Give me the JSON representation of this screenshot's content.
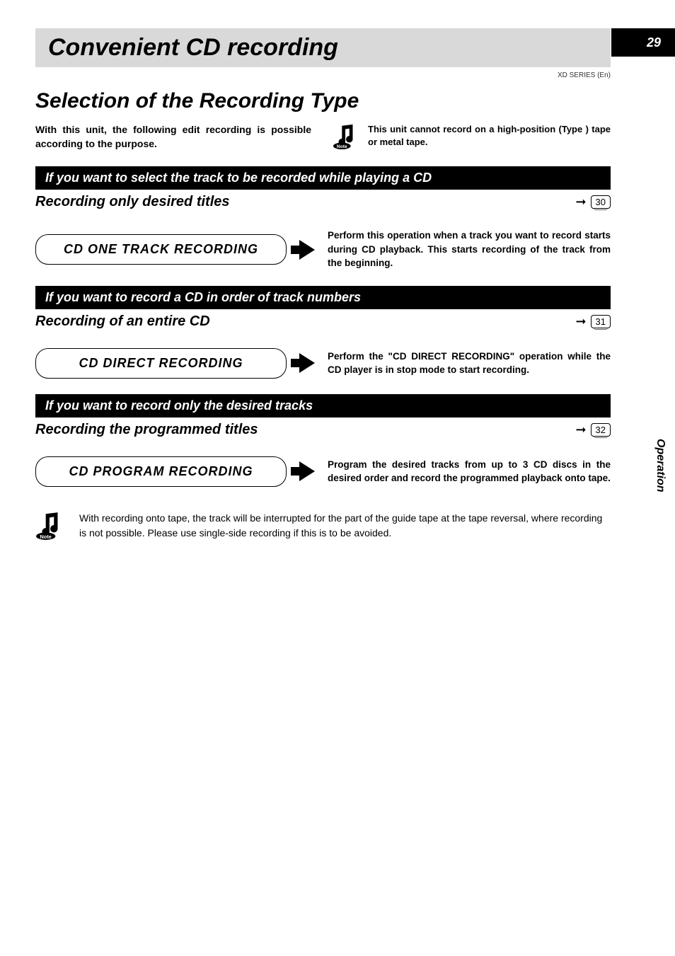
{
  "page_number": "29",
  "series_label": "XD SERIES (En)",
  "side_tab": "Operation",
  "h1": "Convenient CD recording",
  "h2": "Selection of the Recording Type",
  "intro_left": "With this unit, the following edit recording is possible according to the purpose.",
  "intro_note": "This unit cannot record on a high-position (Type ) tape or metal tape.",
  "sections": [
    {
      "bar": "If you want to select the track to be recorded while playing a CD",
      "sub": "Recording only desired titles",
      "page_ref": "30",
      "method": "CD ONE TRACK RECORDING",
      "desc": "Perform this operation when a track you want to record starts during CD playback. This starts recording of the track from the beginning."
    },
    {
      "bar": "If you want to record a CD in order of track numbers",
      "sub": "Recording of an entire CD",
      "page_ref": "31",
      "method": "CD DIRECT RECORDING",
      "desc": "Perform the \"CD DIRECT RECORDING\" operation while the CD player is in stop mode to start recording."
    },
    {
      "bar": "If you want to record only the desired tracks",
      "sub": "Recording the programmed titles",
      "page_ref": "32",
      "method": "CD PROGRAM RECORDING",
      "desc": "Program the desired tracks from up to 3 CD discs in the desired order and record the programmed playback onto tape."
    }
  ],
  "tape_note": "With recording onto tape, the track will be interrupted for the part of the guide tape at the tape reversal, where recording is not possible. Please use single-side recording if this is to be avoided."
}
